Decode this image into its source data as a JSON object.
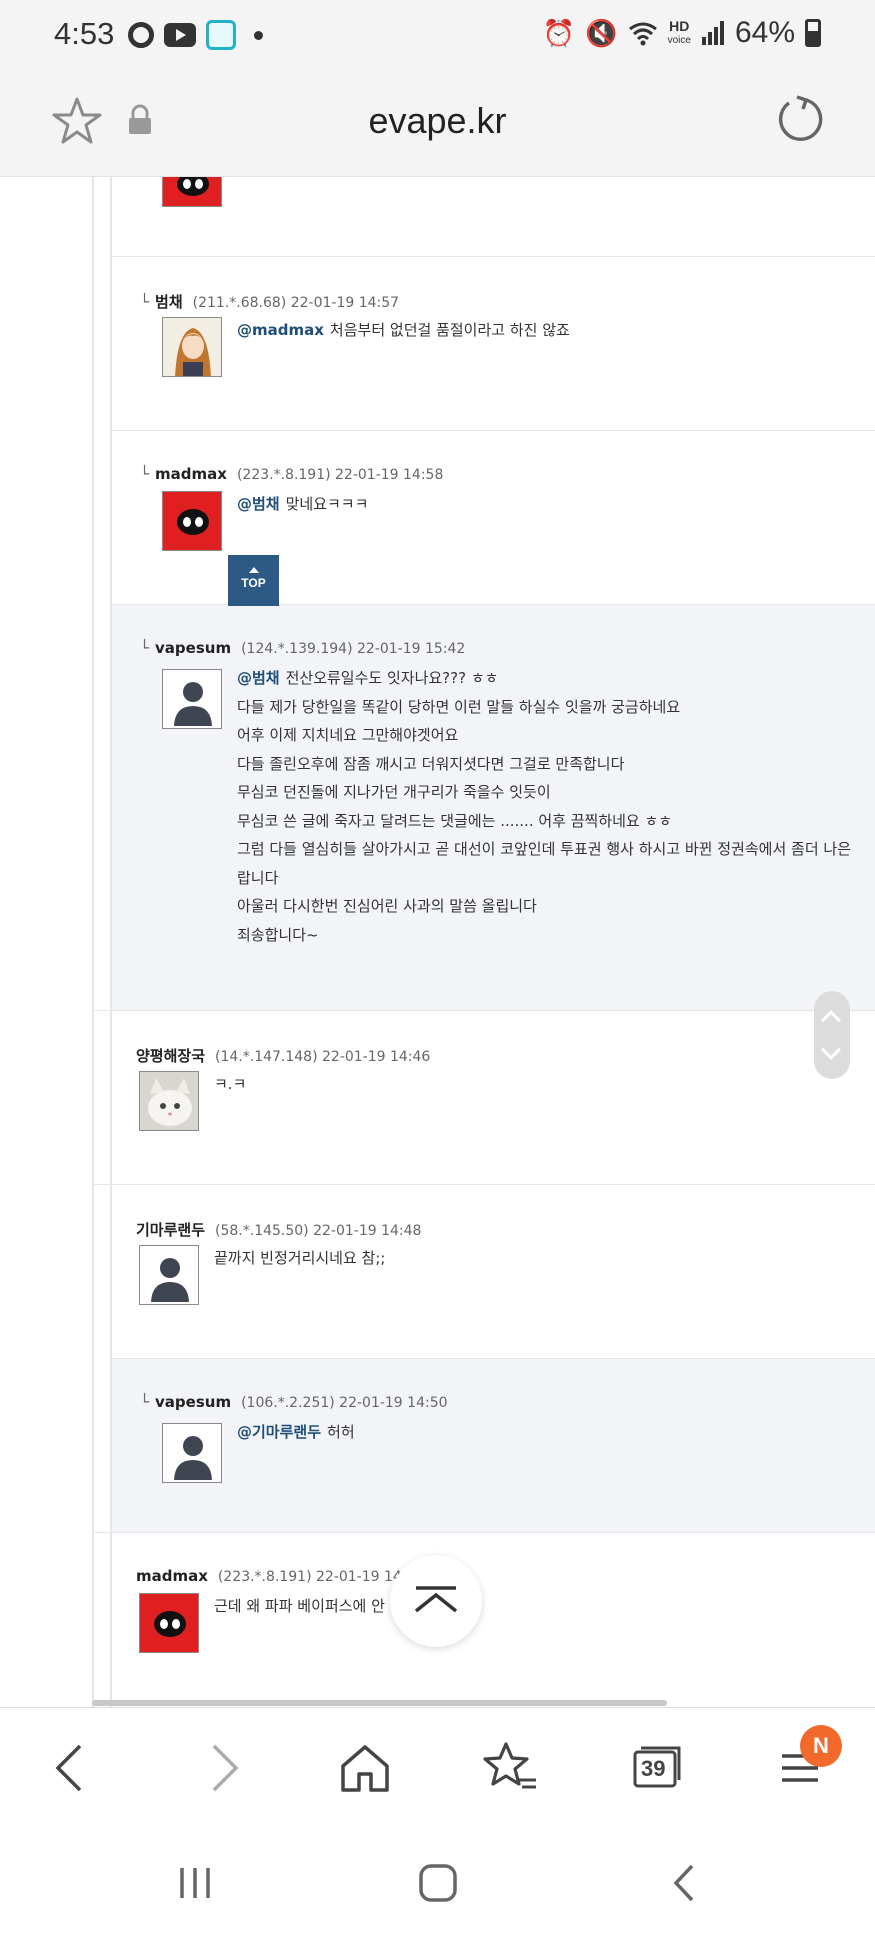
{
  "status_bar": {
    "time": "4:53",
    "battery": "64%",
    "hd_label": "HD",
    "voice_label": "voice"
  },
  "browser": {
    "url": "evape.kr",
    "tabs_count": "39",
    "menu_badge": "N"
  },
  "comments": [
    {
      "nick": "범채",
      "meta": "(211.*.68.68) 22-01-19 14:57",
      "mention": "@madmax",
      "lines": [
        "처음부터 없던걸 품절이라고 하진 않죠"
      ],
      "reply_mark": "└"
    },
    {
      "nick": "madmax",
      "meta": "(223.*.8.191) 22-01-19 14:58",
      "mention": "@범채",
      "lines": [
        "맞네요ㅋㅋㅋ"
      ],
      "reply_mark": "└"
    },
    {
      "nick": "vapesum",
      "meta": "(124.*.139.194) 22-01-19 15:42",
      "mention": "@범채",
      "lines": [
        "전산오류일수도 잇자나요??? ㅎㅎ",
        "다들 제가 당한일을 똑같이 당하면 이런 말들 하실수 잇을까 궁금하네요",
        "어후 이제 지치네요 그만해야겟어요",
        "다들 졸린오후에 잠좀 깨시고 더워지셧다면 그걸로 만족합니다",
        "무심코 던진돌에 지나가던 개구리가 죽을수 잇듯이",
        "무심코 쓴 글에 죽자고 달려드는 댓글에는 ....... 어후 끔찍하네요 ㅎㅎ",
        "그럼 다들 열심히들 살아가시고 곧 대선이 코앞인데 투표권 행사 하시고 바뀐 정권속에서 좀더 나은",
        "랍니다",
        "아울러 다시한번 진심어린 사과의 말씀 올립니다",
        "죄송합니다~"
      ],
      "reply_mark": "└"
    },
    {
      "nick": "양평해장국",
      "meta": "(14.*.147.148) 22-01-19 14:46",
      "lines": [
        "ㅋ.ㅋ"
      ]
    },
    {
      "nick": "기마루랜두",
      "meta": "(58.*.145.50) 22-01-19 14:48",
      "lines": [
        "끝까지 빈정거리시네요 참;;"
      ]
    },
    {
      "nick": "vapesum",
      "meta": "(106.*.2.251) 22-01-19 14:50",
      "mention": "@기마루랜두",
      "lines": [
        "허허"
      ],
      "reply_mark": "└"
    },
    {
      "nick": "madmax",
      "meta": "(223.*.8.191) 22-01-19 14:50",
      "lines": [
        "근데 왜 파파 베이퍼스에 안"
      ]
    }
  ],
  "top_button": "TOP",
  "colors": {
    "mention": "#1f4e79",
    "top_button_bg": "#2d5a85",
    "badge": "#f26a2b",
    "grey_row": "#f2f4f7"
  },
  "icons": {
    "bookmark": "star-icon",
    "lock": "lock-icon",
    "reload": "reload-icon",
    "back": "chevron-left-icon",
    "forward": "chevron-right-icon",
    "home": "home-icon",
    "bookmarks": "star-list-icon",
    "tabs": "tabs-icon",
    "menu": "menu-icon"
  }
}
